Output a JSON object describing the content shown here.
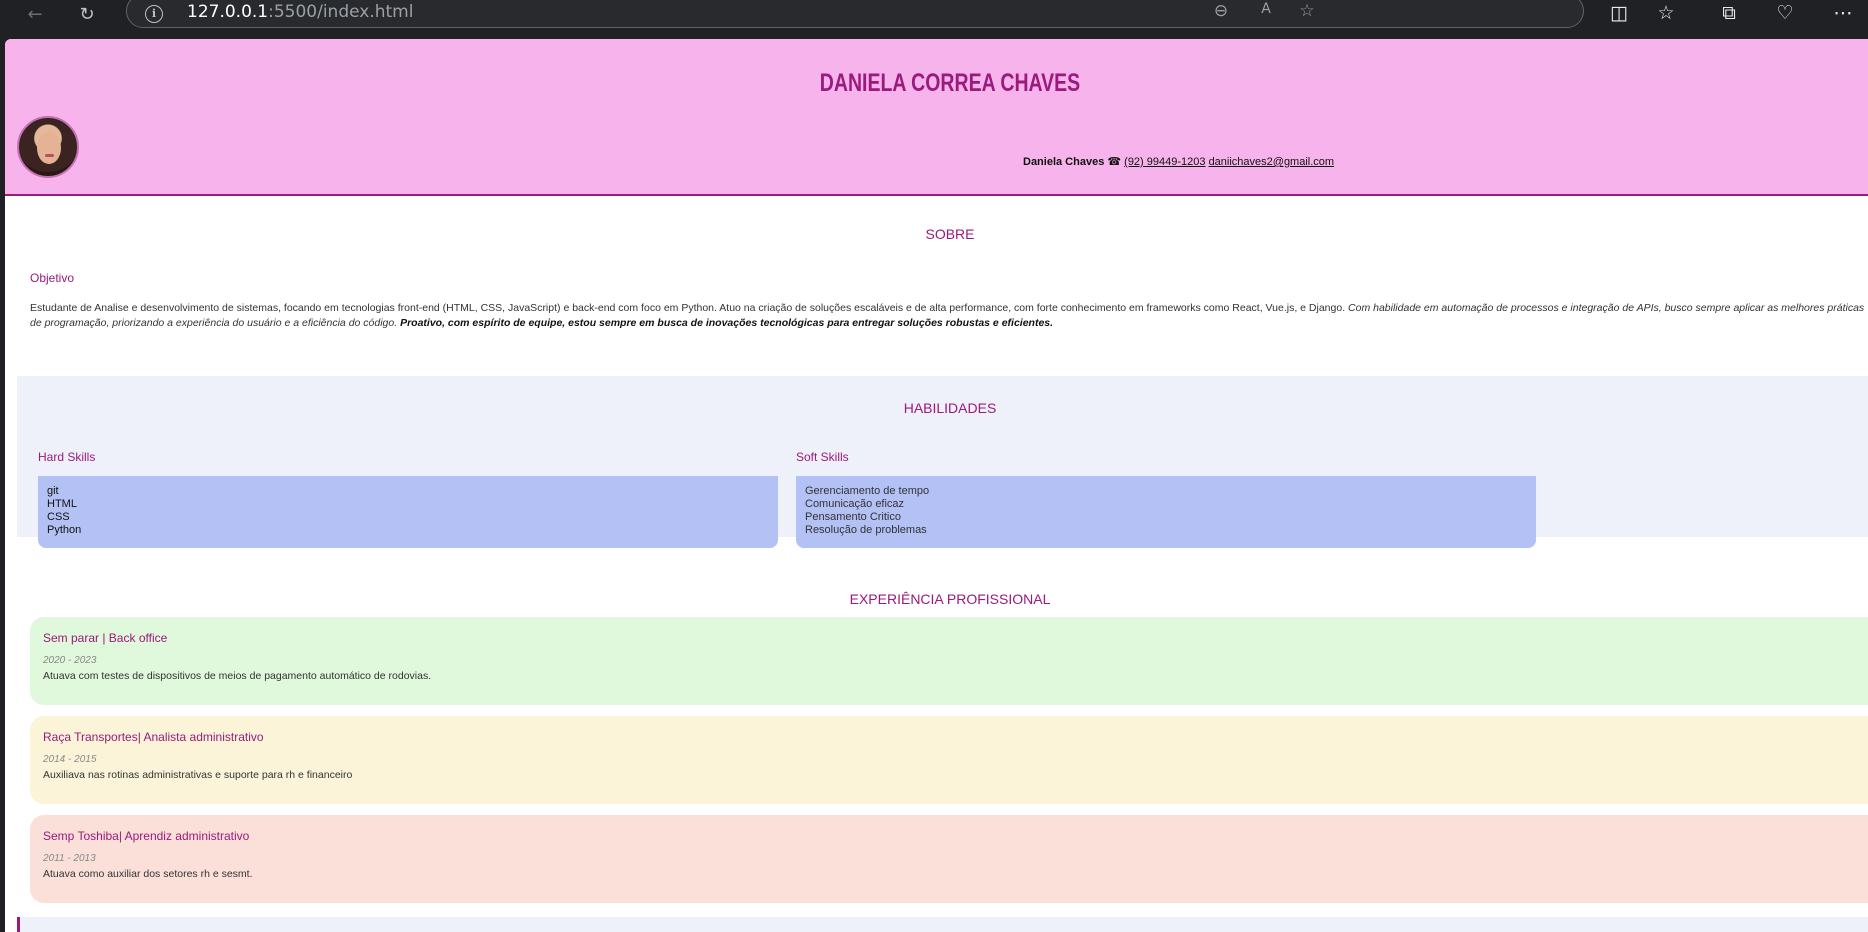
{
  "browser": {
    "url_host": "127.0.0.1",
    "url_rest": ":5500/index.html"
  },
  "header": {
    "name": "DANIELA CORREA CHAVES",
    "contact_name": "Daniela Chaves",
    "phone_icon": "☎",
    "phone": "(92) 99449-1203",
    "email": "daniichaves2@gmail.com"
  },
  "sobre": {
    "title": "SOBRE",
    "objetivo_label": "Objetivo",
    "text_plain": "Estudante de Analise e desenvolvimento de sistemas, focando em tecnologias front-end (HTML, CSS, JavaScript) e back-end com foco em Python. Atuo na criação de soluções escaláveis e de alta performance, com forte conhecimento em frameworks como React, Vue.js, e Django. ",
    "text_italic": "Com habilidade em automação de processos e integração de APIs, busco sempre aplicar as melhores práticas de programação, priorizando a experiência do usuário e a eficiência do código. ",
    "text_bold_italic": "Proativo, com espírito de equipe, estou sempre em busca de inovações tecnológicas para entregar soluções robustas e eficientes."
  },
  "habilidades": {
    "title": "HABILIDADES",
    "hard_label": "Hard Skills",
    "hard": [
      "git",
      "HTML",
      "CSS",
      "Python"
    ],
    "soft_label": "Soft Skills",
    "soft": [
      "Gerenciamento de tempo",
      "Comunicação eficaz",
      "Pensamento Critico",
      "Resolução de problemas"
    ]
  },
  "experiencia": {
    "title": "EXPERIÊNCIA PROFISSIONAL",
    "jobs": [
      {
        "title": "Sem parar | Back office",
        "dates": "2020 - 2023",
        "desc": "Atuava com testes de dispositivos de meios de pagamento automático de rodovias.",
        "color": "#e0f8db"
      },
      {
        "title": "Raça Transportes| Analista administrativo",
        "dates": "2014 - 2015",
        "desc": "Auxiliava nas rotinas administrativas e suporte para rh e financeiro",
        "color": "#fbf4d9"
      },
      {
        "title": "Semp Toshiba| Aprendiz administrativo",
        "dates": "2011 - 2013",
        "desc": "Atuava como auxiliar dos setores rh e sesmt.",
        "color": "#fbdfd9"
      }
    ]
  },
  "colors": {
    "accent": "#9b1a7c",
    "header_bg": "#f7b3ec",
    "skills_bg": "#eef0fa",
    "skill_box": "#b3c1f4"
  }
}
